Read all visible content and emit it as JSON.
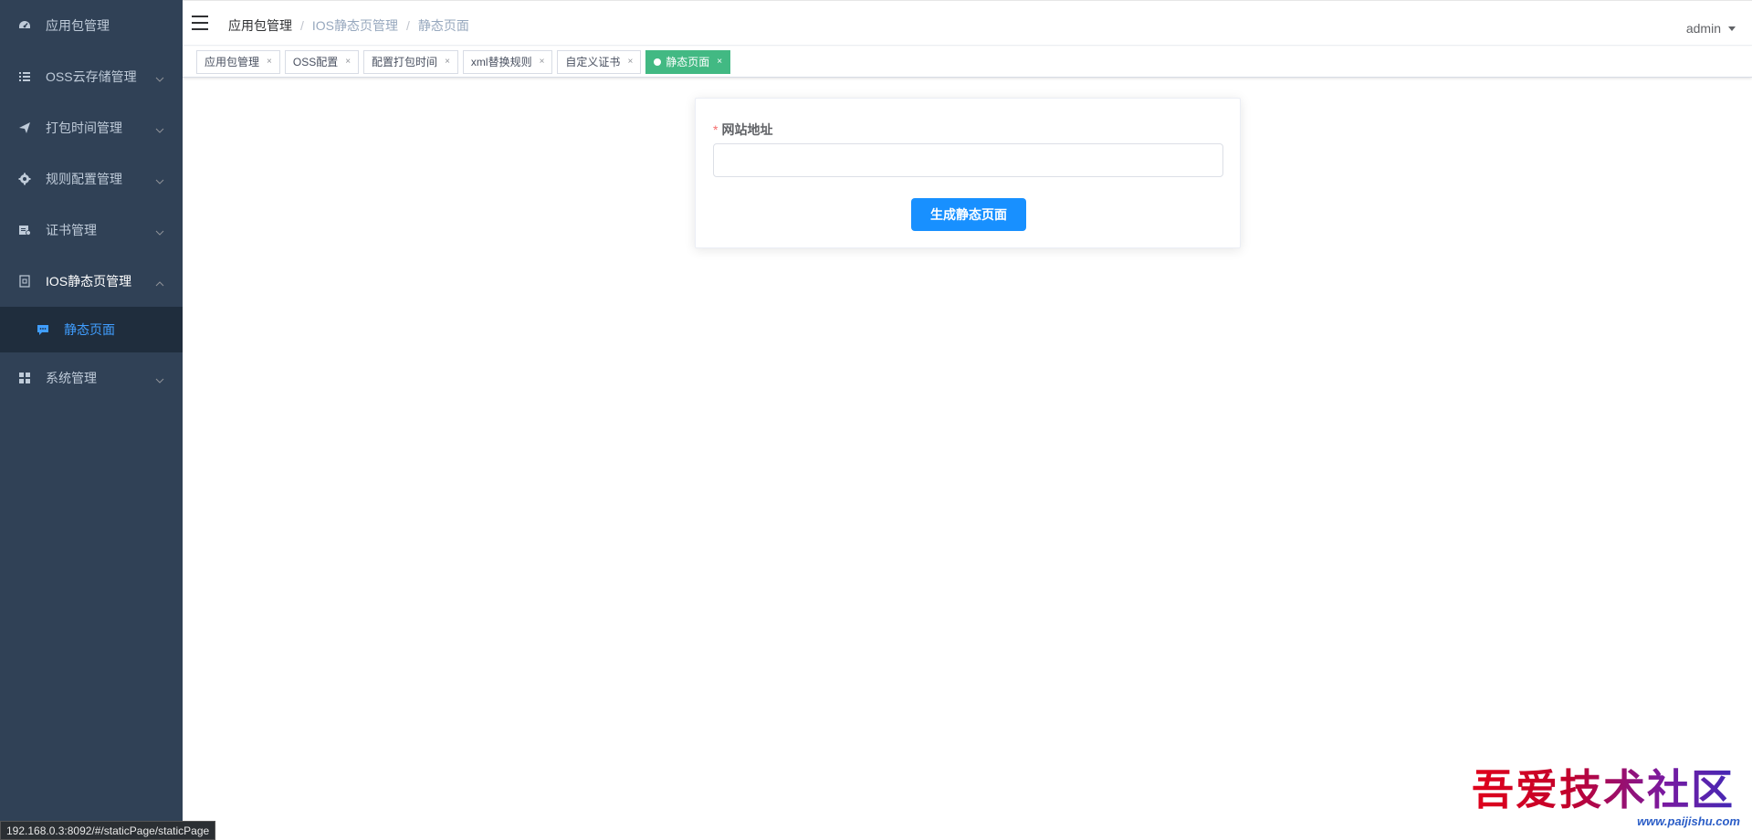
{
  "sidebar": {
    "items": [
      {
        "label": "应用包管理",
        "icon": "dashboard-icon",
        "expandable": false
      },
      {
        "label": "OSS云存储管理",
        "icon": "list-icon",
        "expandable": true
      },
      {
        "label": "打包时间管理",
        "icon": "send-icon",
        "expandable": true
      },
      {
        "label": "规则配置管理",
        "icon": "gear-icon",
        "expandable": true
      },
      {
        "label": "证书管理",
        "icon": "certificate-icon",
        "expandable": true
      },
      {
        "label": "IOS静态页管理",
        "icon": "page-icon",
        "expandable": true,
        "open": true
      },
      {
        "label": "系统管理",
        "icon": "grid-icon",
        "expandable": true
      }
    ],
    "sub_items": [
      {
        "label": "静态页面",
        "icon": "message-icon",
        "active": true
      }
    ]
  },
  "navbar": {
    "breadcrumb": [
      "应用包管理",
      "IOS静态页管理",
      "静态页面"
    ],
    "separator": "/",
    "user": "admin"
  },
  "tags": [
    {
      "label": "应用包管理",
      "active": false
    },
    {
      "label": "OSS配置",
      "active": false
    },
    {
      "label": "配置打包时间",
      "active": false
    },
    {
      "label": "xml替换规则",
      "active": false
    },
    {
      "label": "自定义证书",
      "active": false
    },
    {
      "label": "静态页面",
      "active": true
    }
  ],
  "tag_close": "×",
  "form": {
    "required_mark": "*",
    "label": "网站地址",
    "input_value": "",
    "submit_label": "生成静态页面"
  },
  "status_bar": {
    "url": "192.168.0.3:8092/#/staticPage/staticPage"
  },
  "watermark": {
    "text": "吾爱技术社区",
    "url": "www.paijishu.com"
  },
  "colors": {
    "sidebar_bg": "#304156",
    "submenu_bg": "#1f2d3d",
    "active_text": "#409eff",
    "primary_button": "#1890ff",
    "active_tag": "#42b983"
  }
}
